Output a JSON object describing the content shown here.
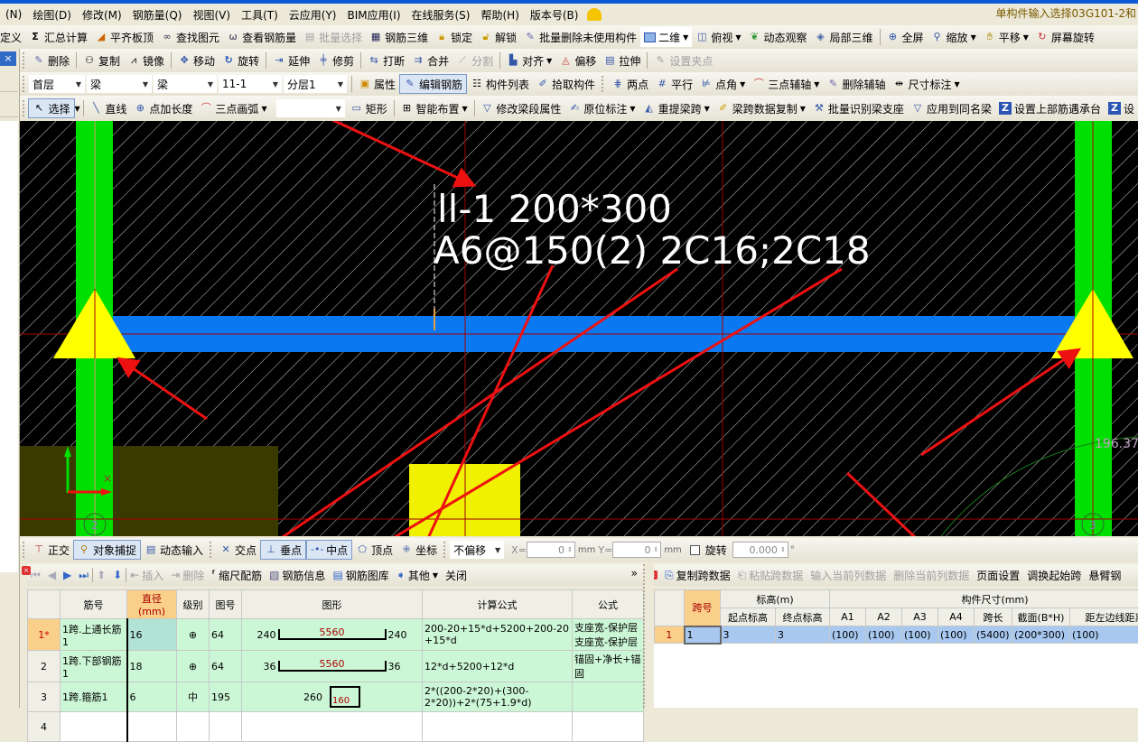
{
  "window_title_right": "单构件输入选择03G101-2和",
  "menu": [
    "(N)",
    "绘图(D)",
    "修改(M)",
    "钢筋量(Q)",
    "视图(V)",
    "工具(T)",
    "云应用(Y)",
    "BIM应用(I)",
    "在线服务(S)",
    "帮助(H)",
    "版本号(B)"
  ],
  "toolbar1": [
    {
      "label": "定义",
      "icon": "define-icon"
    },
    {
      "label": "汇总计算",
      "icon": "sigma-icon"
    },
    {
      "label": "平齐板顶",
      "icon": "align-slab-icon"
    },
    {
      "label": "查找图元",
      "icon": "binoculars-icon"
    },
    {
      "label": "查看钢筋量",
      "icon": "view-rebar-icon"
    },
    {
      "label": "批量选择",
      "icon": "batch-select-icon",
      "disabled": true
    },
    {
      "label": "钢筋三维",
      "icon": "rebar-3d-icon"
    },
    {
      "label": "锁定",
      "icon": "lock-icon"
    },
    {
      "label": "解锁",
      "icon": "unlock-icon"
    },
    {
      "label": "批量删除未使用构件",
      "icon": "batch-delete-icon"
    },
    {
      "label": "二维",
      "icon": "2d-icon",
      "dropdown": true
    },
    {
      "label": "俯视",
      "icon": "top-view-icon",
      "dropdown": true
    },
    {
      "label": "动态观察",
      "icon": "orbit-icon"
    },
    {
      "label": "局部三维",
      "icon": "partial-3d-icon"
    },
    {
      "label": "全屏",
      "icon": "fullscreen-icon"
    },
    {
      "label": "缩放",
      "icon": "zoom-icon",
      "dropdown": true
    },
    {
      "label": "平移",
      "icon": "pan-icon",
      "dropdown": true
    },
    {
      "label": "屏幕旋转",
      "icon": "screen-rotate-icon"
    }
  ],
  "toolbar2": [
    {
      "label": "删除",
      "icon": "delete-icon"
    },
    {
      "label": "复制",
      "icon": "copy-icon"
    },
    {
      "label": "镜像",
      "icon": "mirror-icon"
    },
    {
      "label": "移动",
      "icon": "move-icon"
    },
    {
      "label": "旋转",
      "icon": "rotate-icon"
    },
    {
      "label": "延伸",
      "icon": "extend-icon"
    },
    {
      "label": "修剪",
      "icon": "trim-icon"
    },
    {
      "label": "打断",
      "icon": "break-icon"
    },
    {
      "label": "合并",
      "icon": "merge-icon"
    },
    {
      "label": "分割",
      "icon": "split-icon",
      "disabled": true
    },
    {
      "label": "对齐",
      "icon": "align-icon",
      "dropdown": true
    },
    {
      "label": "偏移",
      "icon": "offset-icon"
    },
    {
      "label": "拉伸",
      "icon": "stretch-icon"
    },
    {
      "label": "设置夹点",
      "icon": "grip-point-icon",
      "disabled": true
    }
  ],
  "selectors": {
    "floor": "首层",
    "category": "梁",
    "type": "梁",
    "component": "11-1",
    "layer": "分层1"
  },
  "toolbar3": [
    {
      "label": "属性",
      "icon": "properties-icon"
    },
    {
      "label": "编辑钢筋",
      "icon": "edit-rebar-icon",
      "active": true
    },
    {
      "label": "构件列表",
      "icon": "component-list-icon"
    },
    {
      "label": "拾取构件",
      "icon": "pick-icon"
    },
    {
      "label": "两点",
      "icon": "two-point-icon"
    },
    {
      "label": "平行",
      "icon": "parallel-icon"
    },
    {
      "label": "点角",
      "icon": "point-angle-icon",
      "dropdown": true
    },
    {
      "label": "三点辅轴",
      "icon": "three-point-axis-icon",
      "dropdown": true
    },
    {
      "label": "删除辅轴",
      "icon": "delete-axis-icon"
    },
    {
      "label": "尺寸标注",
      "icon": "dimension-icon",
      "dropdown": true
    }
  ],
  "toolbar4": [
    {
      "label": "选择",
      "icon": "select-cursor-icon",
      "active": true,
      "dropdown": true
    },
    {
      "label": "直线",
      "icon": "line-icon"
    },
    {
      "label": "点加长度",
      "icon": "point-length-icon"
    },
    {
      "label": "三点画弧",
      "icon": "arc-icon",
      "dropdown": true
    },
    {
      "label": "矩形",
      "icon": "rectangle-icon"
    },
    {
      "label": "智能布置",
      "icon": "smart-layout-icon",
      "dropdown": true
    },
    {
      "label": "修改梁段属性",
      "icon": "modify-beam-icon"
    },
    {
      "label": "原位标注",
      "icon": "in-place-annotation-icon",
      "dropdown": true
    },
    {
      "label": "重提梁跨",
      "icon": "re-span-icon",
      "dropdown": true
    },
    {
      "label": "梁跨数据复制",
      "icon": "span-copy-icon",
      "dropdown": true
    },
    {
      "label": "批量识别梁支座",
      "icon": "batch-identify-icon"
    },
    {
      "label": "应用到同名梁",
      "icon": "apply-same-icon"
    },
    {
      "label": "设置上部筋遇承台",
      "icon": "set-top-rebar-icon"
    },
    {
      "label": "设",
      "icon": "set-icon"
    }
  ],
  "canvas": {
    "annotation_line1": "ll-1 200*300",
    "annotation_line2": "A6@150(2) 2C16;2C18",
    "dimension_text": "196.37",
    "axis_label_left": "2",
    "axis_label_right": "3"
  },
  "snapbar": {
    "items": [
      {
        "label": "正交",
        "icon": "ortho-icon"
      },
      {
        "label": "对象捕捉",
        "icon": "object-snap-icon",
        "active": true
      },
      {
        "label": "动态输入",
        "icon": "dynamic-input-icon"
      },
      {
        "label": "交点",
        "icon": "intersection-icon"
      },
      {
        "label": "垂点",
        "icon": "perpendicular-icon",
        "active": true
      },
      {
        "label": "中点",
        "icon": "midpoint-icon",
        "active": true
      },
      {
        "label": "顶点",
        "icon": "vertex-icon"
      },
      {
        "label": "坐标",
        "icon": "coordinate-icon"
      }
    ],
    "offset_mode": "不偏移",
    "x_label": "X=",
    "x_value": "0",
    "y_label": "Y=",
    "y_value": "0",
    "unit": "mm",
    "rotate_label": "旋转",
    "rotate_value": "0.000",
    "degree": "°"
  },
  "rebar_panel": {
    "toolbar": [
      {
        "label": "插入",
        "icon": "insert-icon",
        "disabled": true
      },
      {
        "label": "删除",
        "icon": "delete-row-icon",
        "disabled": true
      },
      {
        "label": "缩尺配筋",
        "icon": "scale-rebar-icon"
      },
      {
        "label": "钢筋信息",
        "icon": "rebar-info-icon"
      },
      {
        "label": "钢筋图库",
        "icon": "rebar-library-icon"
      },
      {
        "label": "其他",
        "icon": "other-icon",
        "dropdown": true
      },
      {
        "label": "关闭",
        "icon": ""
      }
    ],
    "more": "»",
    "columns": [
      "",
      "筋号",
      "直径(mm)",
      "级别",
      "图号",
      "图形",
      "计算公式",
      "公式"
    ],
    "rows": [
      {
        "rn": "1*",
        "name": "1跨.上通长筋1",
        "dia": "16",
        "grade": "⊕",
        "fig": "64",
        "shape_left": "240",
        "shape_mid": "5560",
        "shape_right": "240",
        "formula": "200-20+15*d+5200+200-20+15*d",
        "desc": "支座宽-保护层 支座宽-保护层"
      },
      {
        "rn": "2",
        "name": "1跨.下部钢筋1",
        "dia": "18",
        "grade": "⊕",
        "fig": "64",
        "shape_left": "36",
        "shape_mid": "5560",
        "shape_right": "36",
        "formula": "12*d+5200+12*d",
        "desc": "锚固+净长+锚固"
      },
      {
        "rn": "3",
        "name": "1跨.箍筋1",
        "dia": "6",
        "grade": "中",
        "fig": "195",
        "shape_left": "260",
        "shape_mid": "160",
        "shape_right": "",
        "formula": "2*((200-2*20)+(300-2*20))+2*(75+1.9*d)",
        "desc": ""
      },
      {
        "rn": "4",
        "name": "",
        "dia": "",
        "grade": "",
        "fig": "",
        "shape_left": "",
        "shape_mid": "",
        "shape_right": "",
        "formula": "",
        "desc": ""
      }
    ]
  },
  "span_panel": {
    "toolbar": [
      {
        "label": "复制跨数据",
        "icon": "copy-span-icon"
      },
      {
        "label": "粘贴跨数据",
        "icon": "paste-span-icon",
        "disabled": true
      },
      {
        "label": "输入当前列数据",
        "disabled": true
      },
      {
        "label": "删除当前列数据",
        "disabled": true
      },
      {
        "label": "页面设置"
      },
      {
        "label": "调换起始跨"
      },
      {
        "label": "悬臂钢"
      }
    ],
    "group_headers": {
      "span_no": "跨号",
      "elevation": "标高(m)",
      "size": "构件尺寸(mm)"
    },
    "columns": [
      "起点标高",
      "终点标高",
      "A1",
      "A2",
      "A3",
      "A4",
      "跨长",
      "截面(B*H)",
      "距左边线距离"
    ],
    "rows": [
      {
        "rn": "1",
        "span": "1",
        "values": [
          "3",
          "3",
          "(100)",
          "(100)",
          "(100)",
          "(100)",
          "(5400)",
          "(200*300)",
          "(100)"
        ]
      }
    ]
  },
  "colors": {
    "column": "#00e000",
    "beam": "#0a78f0",
    "support": "#ffff00",
    "annotation_arrow": "#ee1111",
    "canvas_bg": "#000000"
  }
}
